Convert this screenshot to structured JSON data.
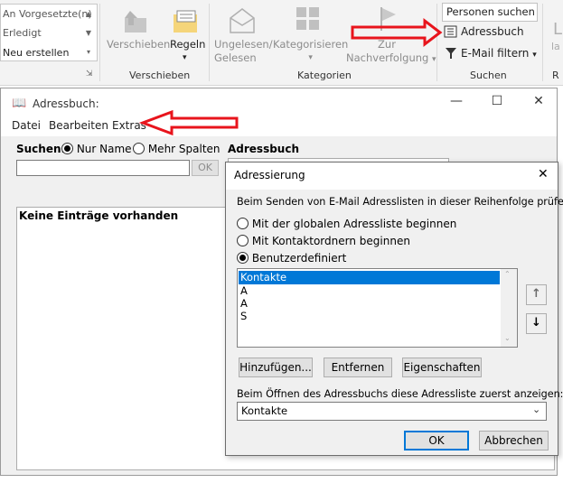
{
  "ribbon": {
    "quick_steps": [
      "An Vorgesetzte(n)",
      "Erledigt",
      "Neu erstellen"
    ],
    "move_group": {
      "verschieben_label": "Verschieben",
      "regeln_label": "Regeln",
      "group_label": "Verschieben"
    },
    "tags_group": {
      "ungelesen_line1": "Ungelesen/",
      "ungelesen_line2": "Gelesen",
      "kategorisieren_label": "Kategorisieren",
      "zur_line1": "Zur",
      "zur_line2": "Nachverfolgung",
      "group_label": "Kategorien"
    },
    "find_group": {
      "personen_suchen": "Personen suchen",
      "adressbuch_label": "Adressbuch",
      "email_filtern_label": "E-Mail filtern",
      "group_label": "Suchen"
    },
    "partial_right_top": "L",
    "partial_right_mid": "la",
    "partial_right_bottom": "R"
  },
  "address_book": {
    "title": "Adressbuch:",
    "menu": [
      "Datei",
      "Bearbeiten",
      "Extras"
    ],
    "search_label": "Suchen:",
    "radio_name_only": "Nur Name",
    "radio_more_columns": "Mehr Spalten",
    "address_book_label": "Adressbuch",
    "ok_label": "OK",
    "empty_text": "Keine Einträge vorhanden"
  },
  "dialog": {
    "title": "Adressierung",
    "instruction": "Beim Senden von E-Mail Adresslisten in dieser Reihenfolge prüfen:",
    "options": [
      {
        "label": "Mit der globalen Adressliste beginnen",
        "selected": false
      },
      {
        "label": "Mit Kontaktordnern beginnen",
        "selected": false
      },
      {
        "label": "Benutzerdefiniert",
        "selected": true
      }
    ],
    "list_items": [
      "Kontakte",
      "A",
      "A",
      "S"
    ],
    "selected_item": "Kontakte",
    "buttons": {
      "add": "Hinzufügen...",
      "remove": "Entfernen",
      "properties": "Eigenschaften",
      "ok": "OK",
      "cancel": "Abbrechen"
    },
    "open_label": "Beim Öffnen des Adressbuchs diese Adressliste zuerst anzeigen:",
    "open_value": "Kontakte"
  },
  "colors": {
    "accent_blue": "#0078d7",
    "annotation_red": "#e8141c",
    "ribbon_bg": "#f3f3f3",
    "dialog_bg": "#f0f0f0"
  },
  "icons": [
    "move-folder-icon",
    "rules-icon",
    "envelope-icon",
    "categorize-grid-icon",
    "flag-icon",
    "address-book-icon",
    "filter-icon",
    "close-icon",
    "minimize-icon",
    "maximize-icon",
    "move-up-icon",
    "move-down-icon",
    "chevron-down-icon"
  ]
}
